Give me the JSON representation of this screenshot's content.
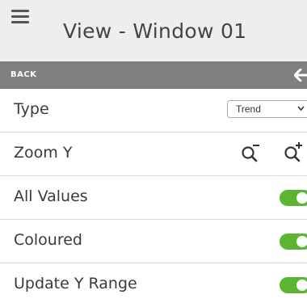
{
  "header": {
    "title": "View - Window 01",
    "menu_icon": "hamburger-menu-icon"
  },
  "backbar": {
    "label": "BACK",
    "icon": "arrow-left-icon"
  },
  "settings": {
    "type": {
      "label": "Type",
      "selected": "Trend"
    },
    "zoom_y": {
      "label": "Zoom Y",
      "zoom_out_icon": "zoom-out-icon",
      "zoom_in_icon": "zoom-in-icon"
    },
    "all_values": {
      "label": "All Values",
      "on": true
    },
    "coloured": {
      "label": "Coloured",
      "on": true
    },
    "update_y_range": {
      "label": "Update Y Range",
      "on": true
    }
  },
  "colors": {
    "header_bg": "#eeeeee",
    "backbar_bg": "#7f7f7f",
    "toggle_on": "#5cb531"
  }
}
